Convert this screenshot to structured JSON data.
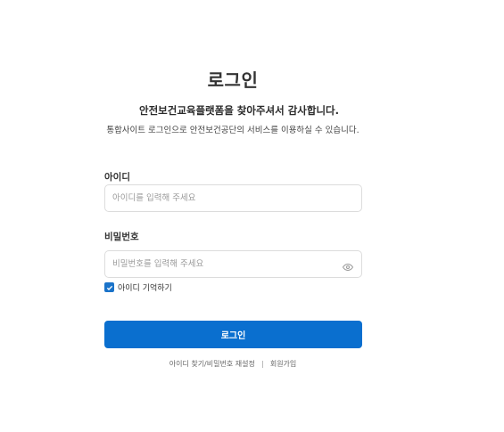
{
  "header": {
    "title": "로그인",
    "subtitle": "안전보건교육플랫폼을 찾아주셔서 감사합니다.",
    "description": "통합사이트 로그인으로 안전보건공단의 서비스를 이용하실 수 있습니다."
  },
  "form": {
    "id_label": "아이디",
    "id_placeholder": "아이디를 입력해 주세요",
    "id_value": "",
    "password_label": "비밀번호",
    "password_placeholder": "비밀번호를 입력해 주세요",
    "password_value": "",
    "password_toggle_icon": "eye-icon",
    "remember_label": "아이디 기억하기",
    "remember_checked": true,
    "submit_label": "로그인"
  },
  "links": {
    "find_account": "아이디 찾기/비밀번호 재설정",
    "signup": "회원가입"
  },
  "colors": {
    "primary": "#0a6fcf",
    "checkbox": "#1a73c9",
    "border": "#dcdcdc"
  }
}
